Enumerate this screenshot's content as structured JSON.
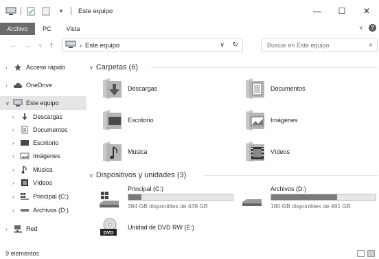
{
  "window": {
    "title": "Este equipo",
    "minimize": "—",
    "maximize": "☐",
    "close": "✕"
  },
  "ribbon": {
    "tabs": [
      "Archivo",
      "PC",
      "Vista"
    ]
  },
  "address": {
    "crumb": "Este equipo",
    "search_placeholder": "Buscar en Este equipo"
  },
  "sidebar": {
    "items": [
      {
        "label": "Acceso rápido",
        "icon": "star-icon"
      },
      {
        "label": "OneDrive",
        "icon": "cloud-icon"
      },
      {
        "label": "Este equipo",
        "icon": "computer-icon"
      },
      {
        "label": "Descargas",
        "icon": "download-icon"
      },
      {
        "label": "Documentos",
        "icon": "document-icon"
      },
      {
        "label": "Escritorio",
        "icon": "desktop-icon"
      },
      {
        "label": "Imágenes",
        "icon": "pictures-icon"
      },
      {
        "label": "Música",
        "icon": "music-icon"
      },
      {
        "label": "Vídeos",
        "icon": "video-icon"
      },
      {
        "label": "Principal (C:)",
        "icon": "drive-windows-icon"
      },
      {
        "label": "Archivos (D:)",
        "icon": "drive-icon"
      },
      {
        "label": "Red",
        "icon": "network-icon"
      }
    ]
  },
  "folders_group": {
    "header": "Carpetas (6)",
    "items": [
      {
        "label": "Descargas",
        "icon": "download-folder-icon"
      },
      {
        "label": "Documentos",
        "icon": "documents-folder-icon"
      },
      {
        "label": "Escritorio",
        "icon": "desktop-folder-icon"
      },
      {
        "label": "Imágenes",
        "icon": "pictures-folder-icon"
      },
      {
        "label": "Música",
        "icon": "music-folder-icon"
      },
      {
        "label": "Vídeos",
        "icon": "videos-folder-icon"
      }
    ]
  },
  "drives_group": {
    "header": "Dispositivos y unidades (3)",
    "drives": [
      {
        "name": "Principal (C:)",
        "free": "384 GB disponibles de 439 GB",
        "used_fraction": 0.125
      },
      {
        "name": "Archivos (D:)",
        "free": "180 GB disponibles de 491 GB",
        "used_fraction": 0.63
      }
    ],
    "dvd": {
      "name": "Unidad de DVD RW (E:)",
      "badge": "DVD"
    }
  },
  "status": {
    "count": "9 elementos"
  }
}
